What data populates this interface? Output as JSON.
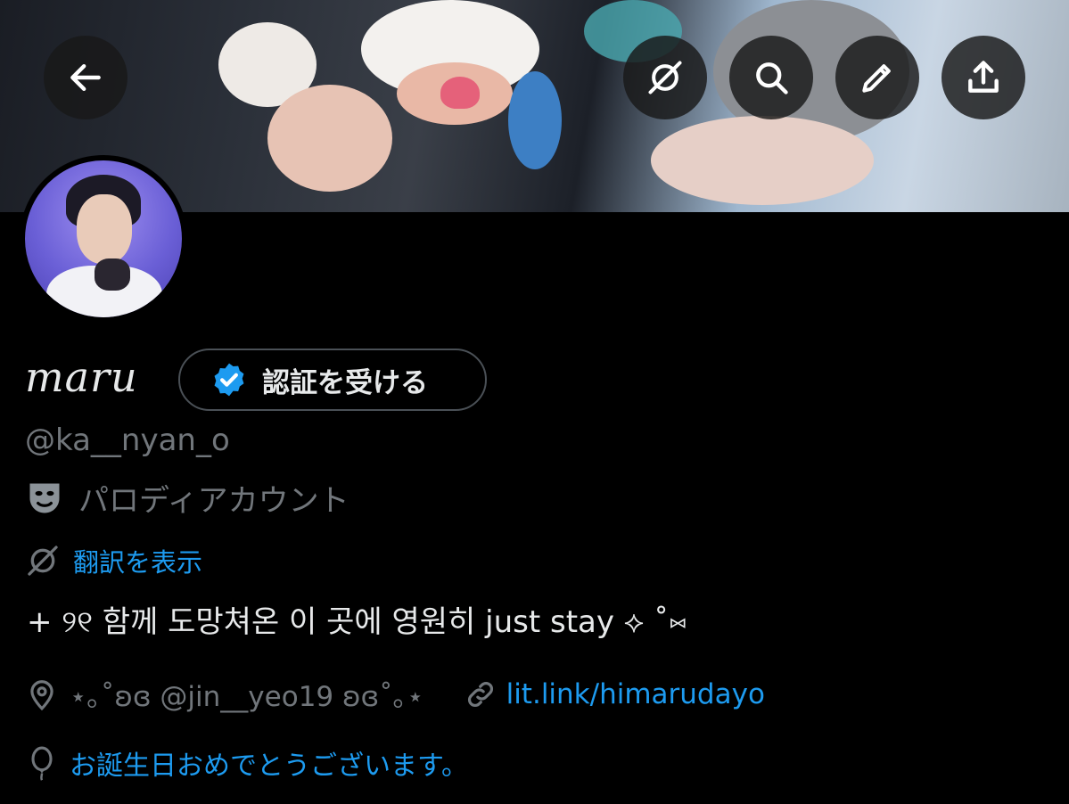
{
  "header": {
    "icons": [
      "back-arrow-icon",
      "grok-icon",
      "search-icon",
      "edit-pencil-icon",
      "share-icon"
    ]
  },
  "profile": {
    "display_name": "maru",
    "verify_button_label": "認証を受ける",
    "handle": "@ka__nyan_o",
    "parody_label": "パロディアカウント",
    "translate_label": "翻訳を表示",
    "bio": "+ ୨୧ 함께 도망쳐온 이 곳에 영원히 just stay ⟡ ˚⑅",
    "location": "⋆｡˚ʚɞ @jin__yeo19 ʚɞ˚｡⋆",
    "website": "lit.link/himarudayo",
    "birthday": "お誕生日おめでとうございます。"
  },
  "colors": {
    "background": "#000000",
    "primary_text": "#e7e9ea",
    "secondary_text": "#71767b",
    "link": "#1d9bf0",
    "verified_badge": "#1d9bf0"
  }
}
